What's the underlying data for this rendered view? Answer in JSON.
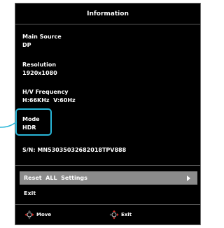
{
  "osd": {
    "title": "Information",
    "main_source": {
      "label": "Main Source",
      "value": "DP"
    },
    "resolution": {
      "label": "Resolution",
      "value": "1920x1080"
    },
    "hv_frequency": {
      "label": "H/V Frequency",
      "value": "H:66KHz  V:60Hz"
    },
    "mode": {
      "label": "Mode",
      "value": "HDR"
    },
    "serial": "S/N: MN53035032682018TPV888",
    "menu": {
      "reset_label": "Reset  ALL  Settings",
      "exit_label": "Exit"
    },
    "footer": {
      "move_label": "Move",
      "exit_label": "Exit"
    }
  },
  "colors": {
    "highlight": "#29b6d8",
    "selected_row": "#8b8b8b",
    "dpad_red": "#e0322a"
  },
  "icons": {
    "move": "dpad-left-right-icon",
    "exit": "dpad-right-icon",
    "submenu": "chevron-right-icon"
  }
}
